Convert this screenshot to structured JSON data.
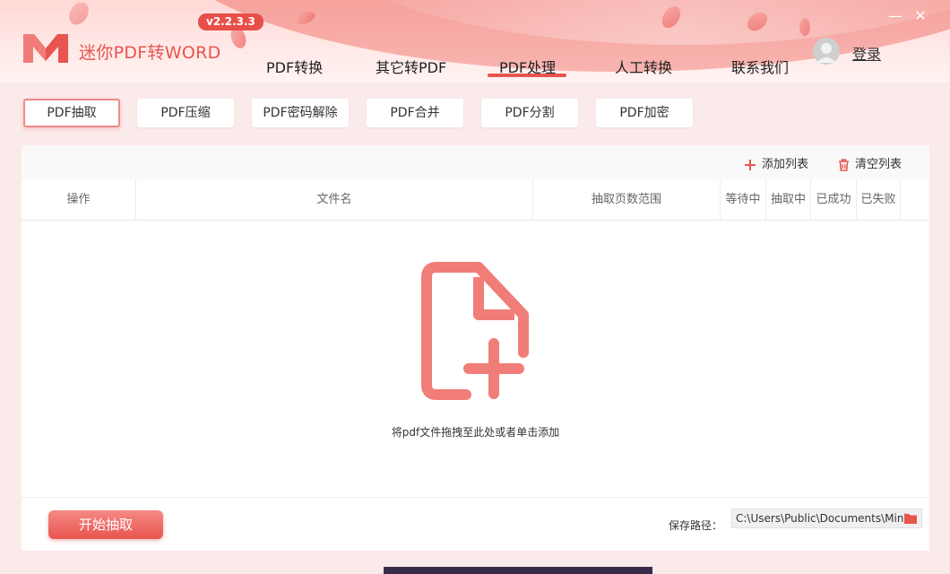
{
  "app": {
    "title": "迷你PDF转WORD",
    "version": "v2.2.3.3",
    "login_label": "登录",
    "minimize_glyph": "—",
    "close_glyph": "✕"
  },
  "nav": {
    "items": [
      {
        "label": "PDF转换"
      },
      {
        "label": "其它转PDF"
      },
      {
        "label": "PDF处理"
      },
      {
        "label": "人工转换"
      },
      {
        "label": "联系我们"
      }
    ],
    "active": "PDF处理"
  },
  "subtabs": {
    "items": [
      {
        "label": "PDF抽取"
      },
      {
        "label": "PDF压缩"
      },
      {
        "label": "PDF密码解除"
      },
      {
        "label": "PDF合并"
      },
      {
        "label": "PDF分割"
      },
      {
        "label": "PDF加密"
      }
    ],
    "active": "PDF抽取"
  },
  "toolbar": {
    "add_label": "添加列表",
    "clear_label": "清空列表"
  },
  "table": {
    "columns": [
      "操作",
      "文件名",
      "抽取页数范围",
      "等待中",
      "抽取中",
      "已成功",
      "已失败"
    ]
  },
  "drop_zone": {
    "hint": "将pdf文件拖拽至此处或者单击添加"
  },
  "footer": {
    "start_label": "开始抽取",
    "save_path_label": "保存路径：",
    "save_path_value": "C:\\Users\\Public\\Documents\\Mini"
  },
  "colors": {
    "accent": "#e8544e",
    "icon": "#f07d78"
  },
  "icons": {
    "logo": "m-logo-icon",
    "add": "plus-icon",
    "clear": "trash-icon",
    "drop": "file-add-icon",
    "folder": "folder-icon",
    "avatar": "user-avatar-icon"
  }
}
